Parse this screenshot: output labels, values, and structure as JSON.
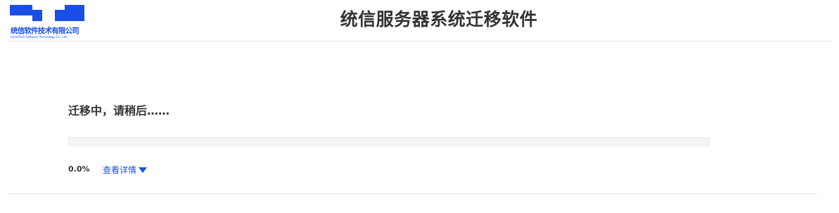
{
  "header": {
    "logo": {
      "company_cn": "统信软件技术有限公司",
      "company_en": "UnionTech Software Technology Co., Ltd.",
      "brand_color": "#1a4fe6"
    },
    "title": "统信服务器系统迁移软件"
  },
  "main": {
    "status_text": "迁移中，请稍后……",
    "progress": {
      "fraction": 0.0,
      "percent_label": "0.0%"
    },
    "details_link": {
      "label": "查看详情",
      "icon": "caret-down-icon"
    }
  }
}
